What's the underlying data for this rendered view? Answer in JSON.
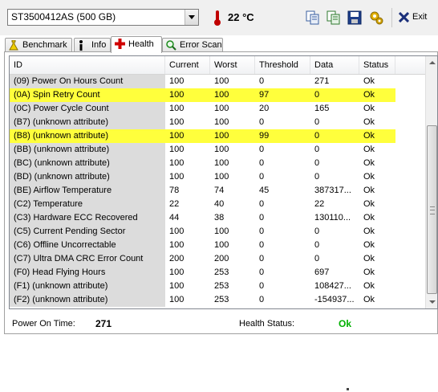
{
  "toolbar": {
    "drive": "ST3500412AS (500 GB)",
    "temperature": "22 °C",
    "temperature_icon": "thermometer-icon",
    "buttons": [
      "copy-icon",
      "copy-all-icon",
      "save-icon",
      "options-icon"
    ],
    "exit_label": "Exit"
  },
  "tabs": [
    {
      "label": "Benchmark",
      "icon": "benchmark-icon"
    },
    {
      "label": "Info",
      "icon": "info-icon"
    },
    {
      "label": "Health",
      "icon": "health-cross-icon",
      "active": true
    },
    {
      "label": "Error Scan",
      "icon": "magnifier-icon"
    }
  ],
  "table": {
    "columns": [
      "ID",
      "Current",
      "Worst",
      "Threshold",
      "Data",
      "Status"
    ],
    "rows": [
      {
        "id": "(09) Power On Hours Count",
        "current": "100",
        "worst": "100",
        "threshold": "0",
        "data": "271",
        "status": "Ok",
        "highlight": false
      },
      {
        "id": "(0A) Spin Retry Count",
        "current": "100",
        "worst": "100",
        "threshold": "97",
        "data": "0",
        "status": "Ok",
        "highlight": true
      },
      {
        "id": "(0C) Power Cycle Count",
        "current": "100",
        "worst": "100",
        "threshold": "20",
        "data": "165",
        "status": "Ok",
        "highlight": false
      },
      {
        "id": "(B7) (unknown attribute)",
        "current": "100",
        "worst": "100",
        "threshold": "0",
        "data": "0",
        "status": "Ok",
        "highlight": false
      },
      {
        "id": "(B8) (unknown attribute)",
        "current": "100",
        "worst": "100",
        "threshold": "99",
        "data": "0",
        "status": "Ok",
        "highlight": true
      },
      {
        "id": "(BB) (unknown attribute)",
        "current": "100",
        "worst": "100",
        "threshold": "0",
        "data": "0",
        "status": "Ok",
        "highlight": false
      },
      {
        "id": "(BC) (unknown attribute)",
        "current": "100",
        "worst": "100",
        "threshold": "0",
        "data": "0",
        "status": "Ok",
        "highlight": false
      },
      {
        "id": "(BD) (unknown attribute)",
        "current": "100",
        "worst": "100",
        "threshold": "0",
        "data": "0",
        "status": "Ok",
        "highlight": false
      },
      {
        "id": "(BE) Airflow Temperature",
        "current": "78",
        "worst": "74",
        "threshold": "45",
        "data": "387317...",
        "status": "Ok",
        "highlight": false
      },
      {
        "id": "(C2) Temperature",
        "current": "22",
        "worst": "40",
        "threshold": "0",
        "data": "22",
        "status": "Ok",
        "highlight": false
      },
      {
        "id": "(C3) Hardware ECC Recovered",
        "current": "44",
        "worst": "38",
        "threshold": "0",
        "data": "130110...",
        "status": "Ok",
        "highlight": false
      },
      {
        "id": "(C5) Current Pending Sector",
        "current": "100",
        "worst": "100",
        "threshold": "0",
        "data": "0",
        "status": "Ok",
        "highlight": false
      },
      {
        "id": "(C6) Offline Uncorrectable",
        "current": "100",
        "worst": "100",
        "threshold": "0",
        "data": "0",
        "status": "Ok",
        "highlight": false
      },
      {
        "id": "(C7) Ultra DMA CRC Error Count",
        "current": "200",
        "worst": "200",
        "threshold": "0",
        "data": "0",
        "status": "Ok",
        "highlight": false
      },
      {
        "id": "(F0) Head Flying Hours",
        "current": "100",
        "worst": "253",
        "threshold": "0",
        "data": "697",
        "status": "Ok",
        "highlight": false
      },
      {
        "id": "(F1) (unknown attribute)",
        "current": "100",
        "worst": "253",
        "threshold": "0",
        "data": "108427...",
        "status": "Ok",
        "highlight": false
      },
      {
        "id": "(F2) (unknown attribute)",
        "current": "100",
        "worst": "253",
        "threshold": "0",
        "data": "-154937...",
        "status": "Ok",
        "highlight": false
      }
    ]
  },
  "summary": {
    "power_on_label": "Power On Time:",
    "power_on_value": "271",
    "health_label": "Health Status:",
    "health_value": "Ok",
    "health_color": "#00b000"
  },
  "colors": {
    "warning_highlight": "#ffff3c",
    "id_column_bg": "#dcdcdc"
  }
}
